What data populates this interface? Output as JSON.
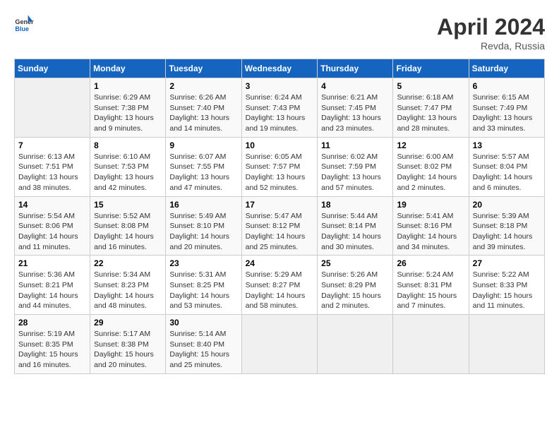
{
  "header": {
    "logo_general": "General",
    "logo_blue": "Blue",
    "title": "April 2024",
    "location": "Revda, Russia"
  },
  "columns": [
    "Sunday",
    "Monday",
    "Tuesday",
    "Wednesday",
    "Thursday",
    "Friday",
    "Saturday"
  ],
  "weeks": [
    [
      {
        "day": "",
        "info": ""
      },
      {
        "day": "1",
        "info": "Sunrise: 6:29 AM\nSunset: 7:38 PM\nDaylight: 13 hours\nand 9 minutes."
      },
      {
        "day": "2",
        "info": "Sunrise: 6:26 AM\nSunset: 7:40 PM\nDaylight: 13 hours\nand 14 minutes."
      },
      {
        "day": "3",
        "info": "Sunrise: 6:24 AM\nSunset: 7:43 PM\nDaylight: 13 hours\nand 19 minutes."
      },
      {
        "day": "4",
        "info": "Sunrise: 6:21 AM\nSunset: 7:45 PM\nDaylight: 13 hours\nand 23 minutes."
      },
      {
        "day": "5",
        "info": "Sunrise: 6:18 AM\nSunset: 7:47 PM\nDaylight: 13 hours\nand 28 minutes."
      },
      {
        "day": "6",
        "info": "Sunrise: 6:15 AM\nSunset: 7:49 PM\nDaylight: 13 hours\nand 33 minutes."
      }
    ],
    [
      {
        "day": "7",
        "info": "Sunrise: 6:13 AM\nSunset: 7:51 PM\nDaylight: 13 hours\nand 38 minutes."
      },
      {
        "day": "8",
        "info": "Sunrise: 6:10 AM\nSunset: 7:53 PM\nDaylight: 13 hours\nand 42 minutes."
      },
      {
        "day": "9",
        "info": "Sunrise: 6:07 AM\nSunset: 7:55 PM\nDaylight: 13 hours\nand 47 minutes."
      },
      {
        "day": "10",
        "info": "Sunrise: 6:05 AM\nSunset: 7:57 PM\nDaylight: 13 hours\nand 52 minutes."
      },
      {
        "day": "11",
        "info": "Sunrise: 6:02 AM\nSunset: 7:59 PM\nDaylight: 13 hours\nand 57 minutes."
      },
      {
        "day": "12",
        "info": "Sunrise: 6:00 AM\nSunset: 8:02 PM\nDaylight: 14 hours\nand 2 minutes."
      },
      {
        "day": "13",
        "info": "Sunrise: 5:57 AM\nSunset: 8:04 PM\nDaylight: 14 hours\nand 6 minutes."
      }
    ],
    [
      {
        "day": "14",
        "info": "Sunrise: 5:54 AM\nSunset: 8:06 PM\nDaylight: 14 hours\nand 11 minutes."
      },
      {
        "day": "15",
        "info": "Sunrise: 5:52 AM\nSunset: 8:08 PM\nDaylight: 14 hours\nand 16 minutes."
      },
      {
        "day": "16",
        "info": "Sunrise: 5:49 AM\nSunset: 8:10 PM\nDaylight: 14 hours\nand 20 minutes."
      },
      {
        "day": "17",
        "info": "Sunrise: 5:47 AM\nSunset: 8:12 PM\nDaylight: 14 hours\nand 25 minutes."
      },
      {
        "day": "18",
        "info": "Sunrise: 5:44 AM\nSunset: 8:14 PM\nDaylight: 14 hours\nand 30 minutes."
      },
      {
        "day": "19",
        "info": "Sunrise: 5:41 AM\nSunset: 8:16 PM\nDaylight: 14 hours\nand 34 minutes."
      },
      {
        "day": "20",
        "info": "Sunrise: 5:39 AM\nSunset: 8:18 PM\nDaylight: 14 hours\nand 39 minutes."
      }
    ],
    [
      {
        "day": "21",
        "info": "Sunrise: 5:36 AM\nSunset: 8:21 PM\nDaylight: 14 hours\nand 44 minutes."
      },
      {
        "day": "22",
        "info": "Sunrise: 5:34 AM\nSunset: 8:23 PM\nDaylight: 14 hours\nand 48 minutes."
      },
      {
        "day": "23",
        "info": "Sunrise: 5:31 AM\nSunset: 8:25 PM\nDaylight: 14 hours\nand 53 minutes."
      },
      {
        "day": "24",
        "info": "Sunrise: 5:29 AM\nSunset: 8:27 PM\nDaylight: 14 hours\nand 58 minutes."
      },
      {
        "day": "25",
        "info": "Sunrise: 5:26 AM\nSunset: 8:29 PM\nDaylight: 15 hours\nand 2 minutes."
      },
      {
        "day": "26",
        "info": "Sunrise: 5:24 AM\nSunset: 8:31 PM\nDaylight: 15 hours\nand 7 minutes."
      },
      {
        "day": "27",
        "info": "Sunrise: 5:22 AM\nSunset: 8:33 PM\nDaylight: 15 hours\nand 11 minutes."
      }
    ],
    [
      {
        "day": "28",
        "info": "Sunrise: 5:19 AM\nSunset: 8:35 PM\nDaylight: 15 hours\nand 16 minutes."
      },
      {
        "day": "29",
        "info": "Sunrise: 5:17 AM\nSunset: 8:38 PM\nDaylight: 15 hours\nand 20 minutes."
      },
      {
        "day": "30",
        "info": "Sunrise: 5:14 AM\nSunset: 8:40 PM\nDaylight: 15 hours\nand 25 minutes."
      },
      {
        "day": "",
        "info": ""
      },
      {
        "day": "",
        "info": ""
      },
      {
        "day": "",
        "info": ""
      },
      {
        "day": "",
        "info": ""
      }
    ]
  ]
}
